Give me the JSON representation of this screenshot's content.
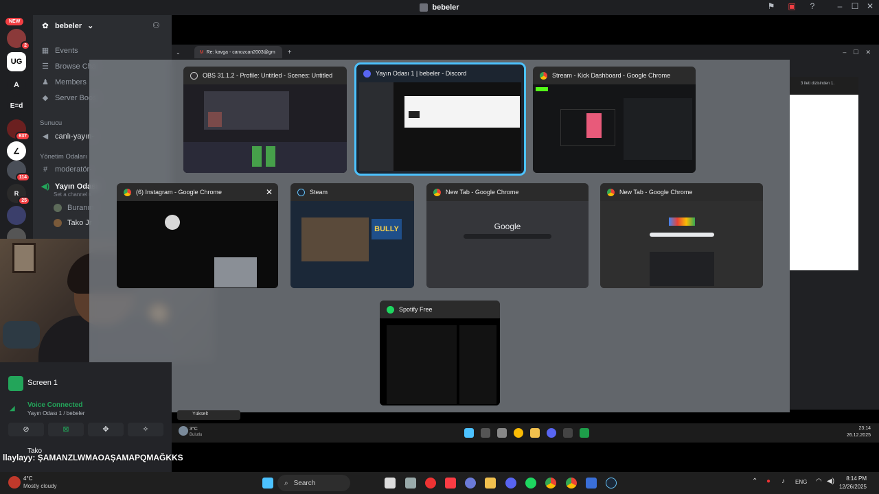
{
  "titlebar": {
    "title": "bebeler"
  },
  "rail": {
    "new_label": "NEW",
    "badges": [
      "2",
      "637",
      "114",
      "25"
    ],
    "letters": [
      "A",
      "E=d"
    ]
  },
  "sidebar": {
    "server_name": "bebeler",
    "items": [
      {
        "label": "Events"
      },
      {
        "label": "Browse Cha"
      },
      {
        "label": "Members"
      },
      {
        "label": "Server Boos"
      }
    ],
    "category_1": "Sunucu",
    "channel_1": "canlı-yayın-",
    "category_2": "Yönetim Odaları",
    "channel_2": "moderatör-",
    "voice_channel": "Yayın Odası",
    "voice_channel_sub": "Set a channel s",
    "members": [
      "Buranın",
      "Tako Jr"
    ]
  },
  "voice_panel": {
    "stream_label": "Screen 1",
    "status": "Voice Connected",
    "status_sub": "Yayın Odası 1 / bebeler"
  },
  "user_panel": {
    "username": "Tako"
  },
  "chat": {
    "line": "llaylayy: ŞAMANZLWMAOAŞAMAPQMAĞKKS"
  },
  "bg_chrome": {
    "tab_title": "Re: kavga - canozcan2003@gm",
    "side_text": "3 ileti dizisinden 1."
  },
  "switcher": {
    "cards": [
      {
        "title": "OBS 31.1.2 - Profile: Untitled - Scenes: Untitled"
      },
      {
        "title": "Yayın Odası 1 | bebeler - Discord"
      },
      {
        "title": "Stream - Kick Dashboard - Google Chrome"
      },
      {
        "title": "(6) Instagram - Google Chrome"
      },
      {
        "title": "Steam"
      },
      {
        "title": "New Tab - Google Chrome"
      },
      {
        "title": "New Tab - Google Chrome"
      },
      {
        "title": "Spotify Free"
      }
    ],
    "google_label": "Google",
    "steam_banner": "BULLY"
  },
  "inner_taskbar": {
    "weather_temp": "3°C",
    "weather_desc": "Bulutlu",
    "time": "23:14",
    "date": "26.12.2025",
    "bottom_left": "Yükselt"
  },
  "taskbar": {
    "weather_temp": "4°C",
    "weather_desc": "Mostly cloudy",
    "search_placeholder": "Search",
    "lang": "ENG",
    "time": "8:14 PM",
    "date": "12/26/2025"
  },
  "colors": {
    "accent": "#4cc2ff",
    "discord_green": "#23a55a",
    "discord_red": "#f23f43"
  }
}
